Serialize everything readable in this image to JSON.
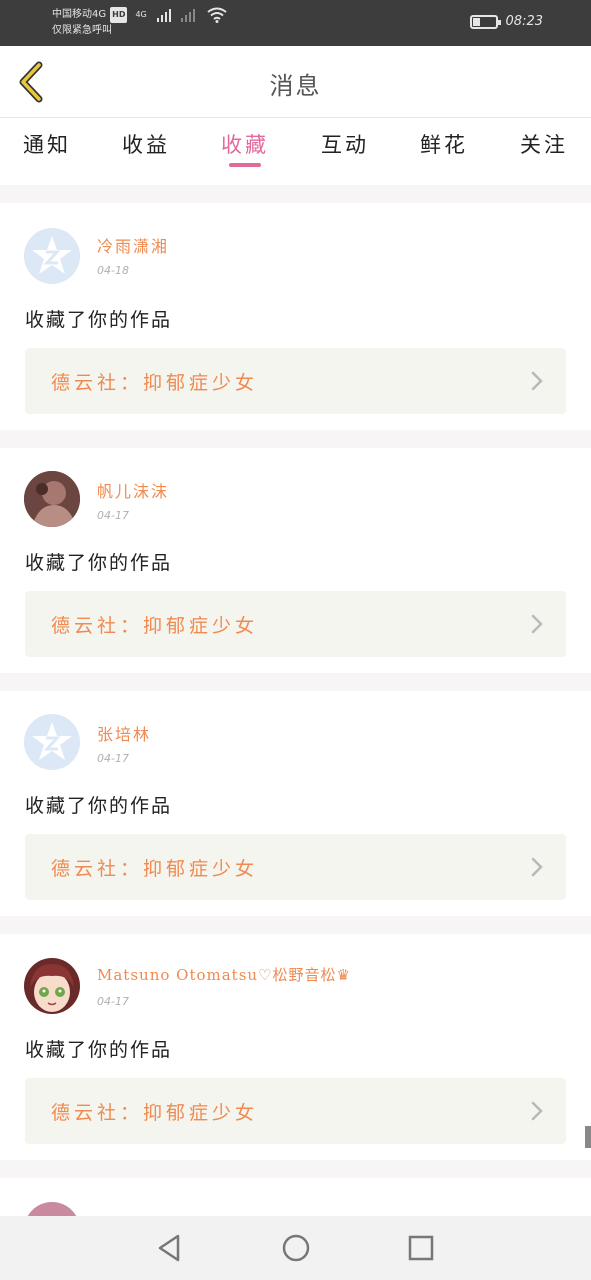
{
  "status_bar": {
    "carrier": "中国移动4G",
    "hd": "HD",
    "emergency": "仅限紧急呼叫",
    "network": "4G",
    "time": "08:23",
    "battery_level": 0.3
  },
  "header": {
    "title": "消息"
  },
  "tabs": [
    {
      "label": "通知"
    },
    {
      "label": "收益"
    },
    {
      "label": "收藏"
    },
    {
      "label": "互动"
    },
    {
      "label": "鲜花"
    },
    {
      "label": "关注"
    }
  ],
  "active_tab": "收藏",
  "items": [
    {
      "user": "冷雨潇湘",
      "date": "04-18",
      "action": "收藏了你的作品",
      "work": "德云社：抑郁症少女",
      "avatar": "default-avatar-icon"
    },
    {
      "user": "帆儿沫沫",
      "date": "04-17",
      "action": "收藏了你的作品",
      "work": "德云社：抑郁症少女",
      "avatar": "photo-avatar"
    },
    {
      "user": "张培林",
      "date": "04-17",
      "action": "收藏了你的作品",
      "work": "德云社：抑郁症少女",
      "avatar": "default-avatar-icon"
    },
    {
      "user": "Matsuno Otomatsu♡松野音松♛",
      "date": "04-17",
      "action": "收藏了你的作品",
      "work": "德云社：抑郁症少女",
      "avatar": "anime-avatar"
    }
  ],
  "colors": {
    "accent_pink": "#e06a9b",
    "accent_orange": "#ef8a50",
    "back_arrow": "#e8c93a"
  }
}
